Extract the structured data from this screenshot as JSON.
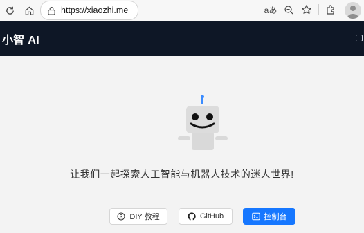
{
  "browser": {
    "url": "https://xiaozhi.me",
    "read_aloud_label": "aあ"
  },
  "app": {
    "title": "小智 AI"
  },
  "main": {
    "tagline": "让我们一起探索人工智能与机器人技术的迷人世界!",
    "buttons": {
      "diy": "DIY 教程",
      "github": "GitHub",
      "console": "控制台"
    }
  },
  "colors": {
    "header_bg": "#0e1726",
    "primary": "#1677ff",
    "page_bg": "#f3f3f3"
  }
}
